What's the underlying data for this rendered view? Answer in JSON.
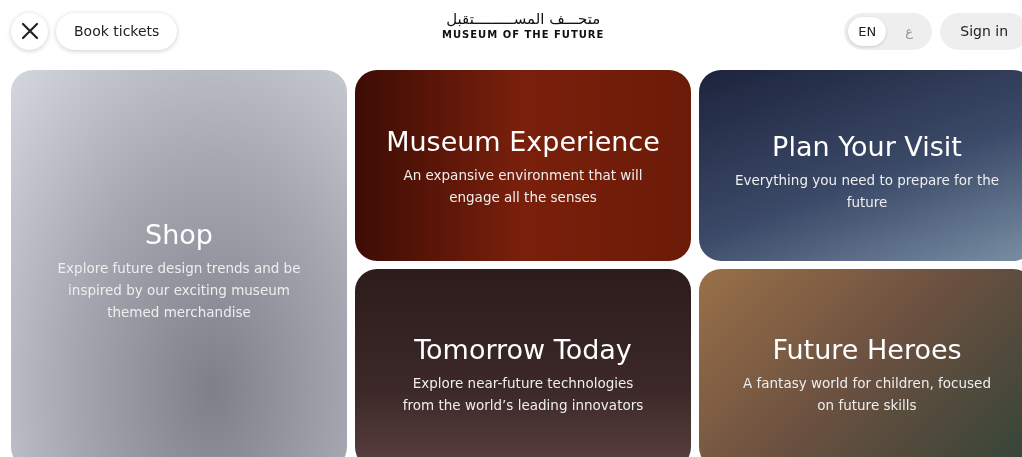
{
  "header": {
    "book_button": "Book tickets",
    "logo_arabic": "متحـــف المســـــــــتقبل",
    "logo_english": "MUSEUM OF THE FUTURE",
    "languages": [
      {
        "label": "EN",
        "selected": true
      },
      {
        "label": "ع",
        "selected": false
      }
    ],
    "sign_in": "Sign in"
  },
  "cards": [
    {
      "kind": "shop",
      "title": "Shop",
      "description": "Explore future design trends and be inspired by our exciting museum themed merchandise"
    },
    {
      "kind": "experience",
      "title": "Museum Experience",
      "description": "An expansive environment that will engage all the senses"
    },
    {
      "kind": "visit",
      "title": "Plan Your Visit",
      "description": "Everything you need to prepare for the future"
    },
    {
      "kind": "tomorrow",
      "title": "Tomorrow Today",
      "description": "Explore near-future technologies from the world’s leading innovators"
    },
    {
      "kind": "heroes",
      "title": "Future Heroes",
      "description": "A fantasy world for children, focused on future skills"
    }
  ]
}
